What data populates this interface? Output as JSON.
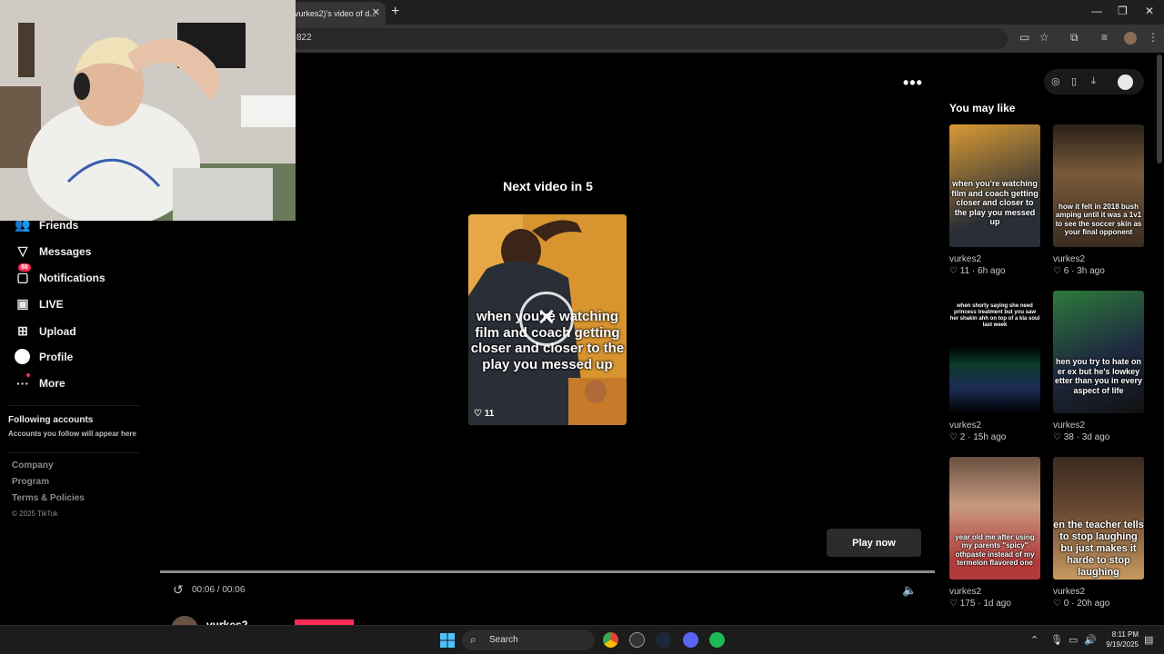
{
  "browser": {
    "tab_title": "vurkes2)'s video of d...",
    "url": "822",
    "icons": [
      "close-icon",
      "plus-icon",
      "minimize-icon",
      "restore-icon",
      "window-close-icon",
      "cast-icon",
      "star-icon",
      "extensions-icon",
      "media-icon",
      "menu-icon"
    ]
  },
  "sidebar": {
    "items": [
      {
        "label": "Friends",
        "icon": "friends-icon"
      },
      {
        "label": "Messages",
        "icon": "messages-icon"
      },
      {
        "label": "Notifications",
        "icon": "notifications-icon",
        "badge": "88"
      },
      {
        "label": "LIVE",
        "icon": "live-icon"
      },
      {
        "label": "Upload",
        "icon": "upload-icon"
      },
      {
        "label": "Profile",
        "icon": "profile-icon"
      },
      {
        "label": "More",
        "icon": "more-icon"
      }
    ],
    "following_title": "Following accounts",
    "following_sub": "Accounts you follow will appear here",
    "footer": [
      "Company",
      "Program",
      "Terms & Policies"
    ],
    "copyright": "© 2025 TikTok"
  },
  "main": {
    "next_title": "Next video in 5",
    "next_caption": "when you're watching film and coach getting closer and closer to the play you messed up",
    "next_likes": "11",
    "play_now": "Play now",
    "time": "00:06 / 00:06",
    "progress": 1.0,
    "creator_name": "vurkes2",
    "accent": "#fe2c55"
  },
  "recommend": {
    "title": "You may like",
    "items": [
      {
        "caption": "when you're watching film and coach getting closer and closer to the play you messed up",
        "author": "vurkes2",
        "likes": "11",
        "age": "6h ago"
      },
      {
        "caption": "how it felt in 2018 bush amping until it was a 1v1 to see the soccer skin as your final opponent",
        "author": "vurkes2",
        "likes": "6",
        "age": "3h ago"
      },
      {
        "caption": "when shorty saying she need princess treatment but you saw her shakin ahh on top of a kia soul last week",
        "author": "vurkes2",
        "likes": "2",
        "age": "15h ago"
      },
      {
        "caption": "hen you try to hate on er ex but he's lowkey etter than you in every aspect of life",
        "author": "vurkes2",
        "likes": "38",
        "age": "3d ago"
      },
      {
        "caption": "year old me after using my parents \"spicy\" othpaste instead of my termelon flavored one",
        "author": "vurkes2",
        "likes": "175",
        "age": "1d ago"
      },
      {
        "caption": "en the teacher tells to stop laughing bu just makes it harde to stop laughing",
        "author": "vurkes2",
        "likes": "0",
        "age": "20h ago"
      }
    ]
  },
  "taskbar": {
    "search_label": "Search",
    "time": "8:11 PM",
    "date": "9/19/2025"
  }
}
